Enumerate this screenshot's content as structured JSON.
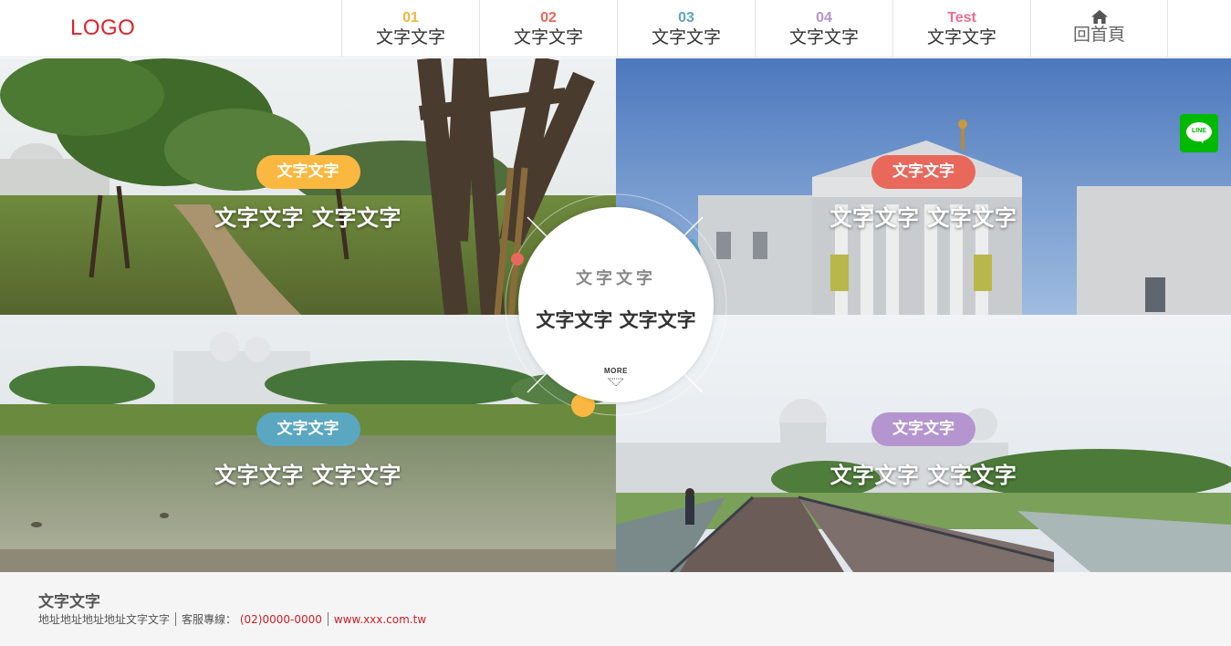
{
  "header": {
    "logo": "LOGO",
    "nav": [
      {
        "num": "01",
        "label": "文字文字",
        "color": "#f5b73b"
      },
      {
        "num": "02",
        "label": "文字文字",
        "color": "#e8685c"
      },
      {
        "num": "03",
        "label": "文字文字",
        "color": "#5aa7c1"
      },
      {
        "num": "04",
        "label": "文字文字",
        "color": "#b595cf"
      },
      {
        "num": "Test",
        "label": "文字文字",
        "color": "#ef6d8e"
      }
    ],
    "home": {
      "label": "回首頁",
      "icon": "home-icon"
    }
  },
  "panels": [
    {
      "badge": "文字文字",
      "title": "文字文字 文字文字",
      "badge_color": "#fbb840"
    },
    {
      "badge": "文字文字",
      "title": "文字文字 文字文字",
      "badge_color": "#e8685c"
    },
    {
      "badge": "文字文字",
      "title": "文字文字 文字文字",
      "badge_color": "#5aa7c1"
    },
    {
      "badge": "文字文字",
      "title": "文字文字 文字文字",
      "badge_color": "#b595cf"
    }
  ],
  "center": {
    "subtitle": "文字文字",
    "title": "文字文字 文字文字",
    "more": "MORE"
  },
  "line_button": {
    "label": "LINE",
    "color": "#00b900"
  },
  "footer": {
    "title": "文字文字",
    "address": "地址地址地址地址文字文字",
    "phone_label": "客服專線：",
    "phone": "(02)0000-0000",
    "website": "www.xxx.com.tw"
  }
}
